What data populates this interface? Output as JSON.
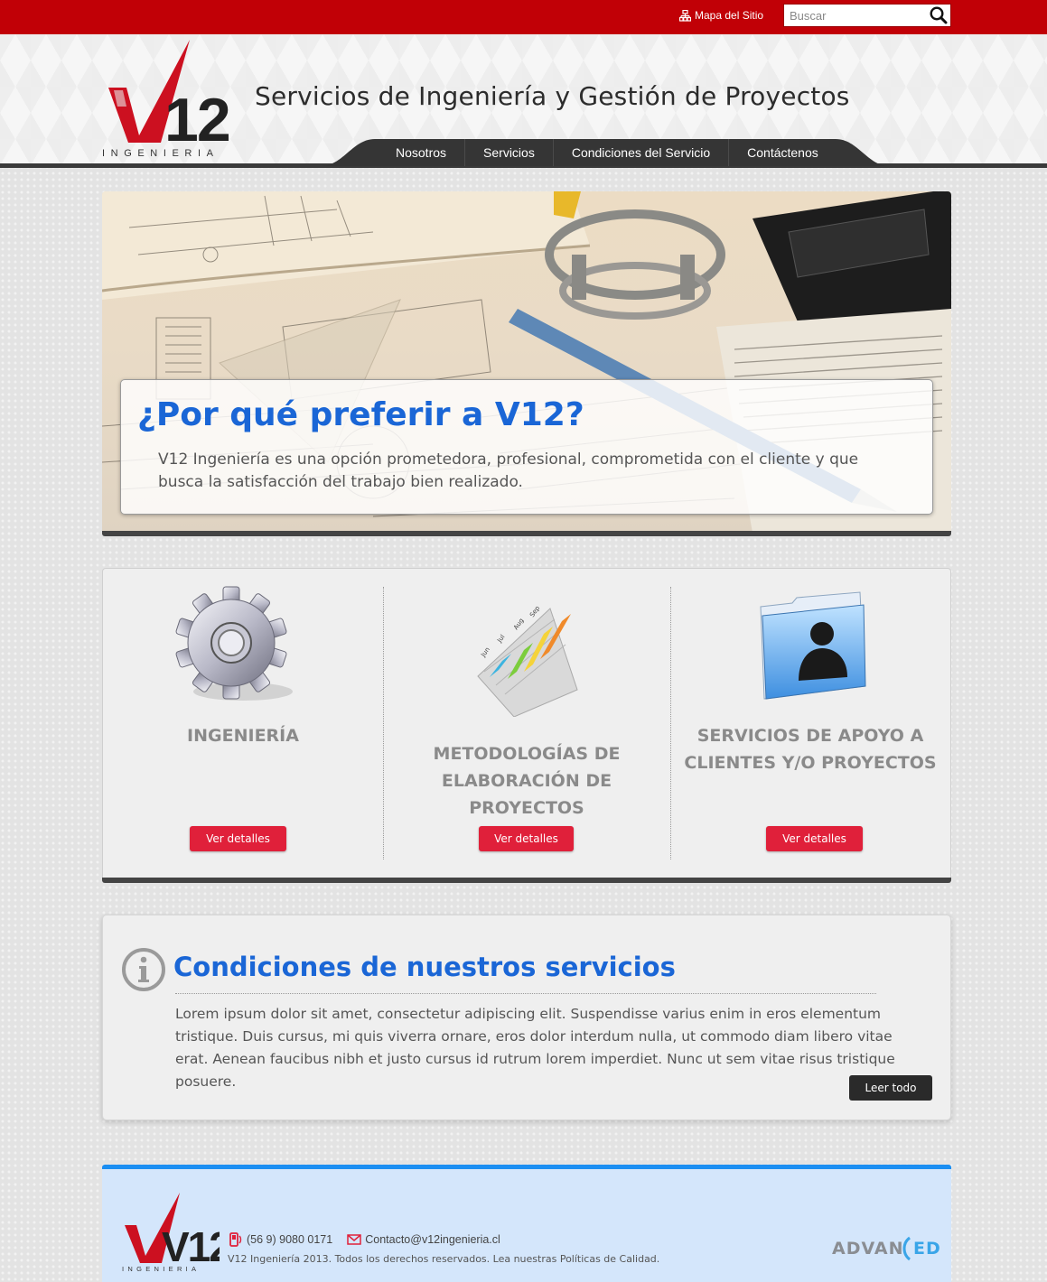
{
  "topbar": {
    "sitemap_label": "Mapa del Sitio",
    "search_placeholder": "Buscar",
    "search_value": "",
    "background": "#c10006"
  },
  "header": {
    "logo_text": "V12",
    "logo_subtext": "INGENIERIA",
    "tagline": "Servicios de Ingeniería y Gestión de Proyectos",
    "nav": [
      "Nosotros",
      "Servicios",
      "Condiciones del Servicio",
      "Contáctenos"
    ]
  },
  "hero": {
    "title": "¿Por qué preferir a V12?",
    "text": "V12 Ingeniería es una opción prometedora, profesional, comprometida con el cliente y que busca la satisfacción del trabajo bien realizado."
  },
  "services": [
    {
      "title": "INGENIERÍA",
      "button": "Ver detalles",
      "icon": "gear-icon"
    },
    {
      "title": "METODOLOGÍAS DE ELABORACIÓN DE PROYECTOS",
      "button": "Ver detalles",
      "icon": "bar-chart-icon",
      "chart_labels": [
        "Jun",
        "Jul",
        "Aug",
        "Sep"
      ]
    },
    {
      "title": "SERVICIOS DE APOYO A CLIENTES Y/O PROYECTOS",
      "button": "Ver detalles",
      "icon": "user-folder-icon"
    }
  ],
  "conditions": {
    "title": "Condiciones de nuestros servicios",
    "text": "Lorem ipsum dolor sit amet, consectetur adipiscing elit. Suspendisse varius enim in eros elementum tristique. Duis cursus, mi quis viverra ornare, eros dolor interdum nulla, ut commodo diam libero vitae erat. Aenean faucibus nibh et justo cursus id rutrum lorem imperdiet. Nunc ut sem vitae risus tristique posuere.",
    "button": "Leer todo",
    "icon": "info-icon"
  },
  "footer": {
    "phone": "(56 9) 9080 0171",
    "email": "Contacto@v12ingenieria.cl",
    "copyright": "V12 Ingeniería 2013. Todos los derechos reservados. Lea nuestras Políticas de Calidad.",
    "partner_logo": "ADVANCED"
  },
  "colors": {
    "brand_red": "#c10006",
    "title_blue": "#1a66d6",
    "button_red": "#e0203a",
    "footer_bg": "#d4e6fb",
    "footer_accent": "#1a8ef2"
  }
}
